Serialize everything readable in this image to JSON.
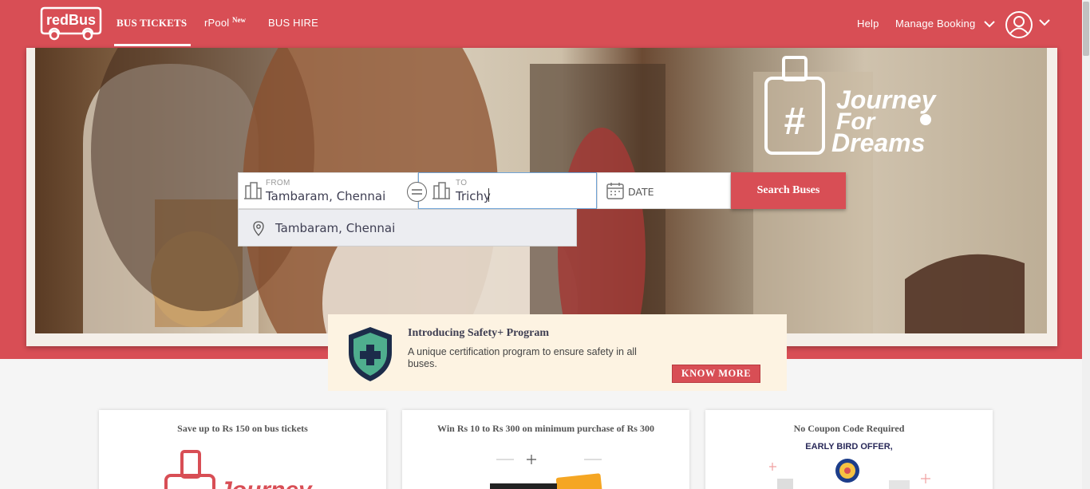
{
  "header": {
    "logo_text": "redBus",
    "nav": {
      "bus_tickets": "BUS TICKETS",
      "rpool": "rPool",
      "rpool_badge": "New",
      "bus_hire": "BUS HIRE"
    },
    "help": "Help",
    "manage_booking": "Manage Booking",
    "brand_color": "#d84e55"
  },
  "hero": {
    "tagline_line1": "Journey",
    "tagline_line2": "For",
    "tagline_line3": "Dreams",
    "tagline_symbol": "#"
  },
  "search": {
    "from_label": "FROM",
    "from_value": "Tambaram, Chennai",
    "to_label": "TO",
    "to_value": "Trichy",
    "date_placeholder": "DATE",
    "button": "Search Buses",
    "suggestion": "Tambaram, Chennai"
  },
  "safety": {
    "title": "Introducing Safety+ Program",
    "description": "A unique certification program to ensure safety in all buses.",
    "button": "KNOW MORE"
  },
  "offers": [
    {
      "title": "Save up to Rs 150 on bus tickets",
      "image_text": "Journey"
    },
    {
      "title": "Win Rs 10 to Rs 300 on minimum purchase of Rs 300"
    },
    {
      "title": "No Coupon Code Required",
      "subtitle": "EARLY BIRD OFFER,"
    }
  ]
}
